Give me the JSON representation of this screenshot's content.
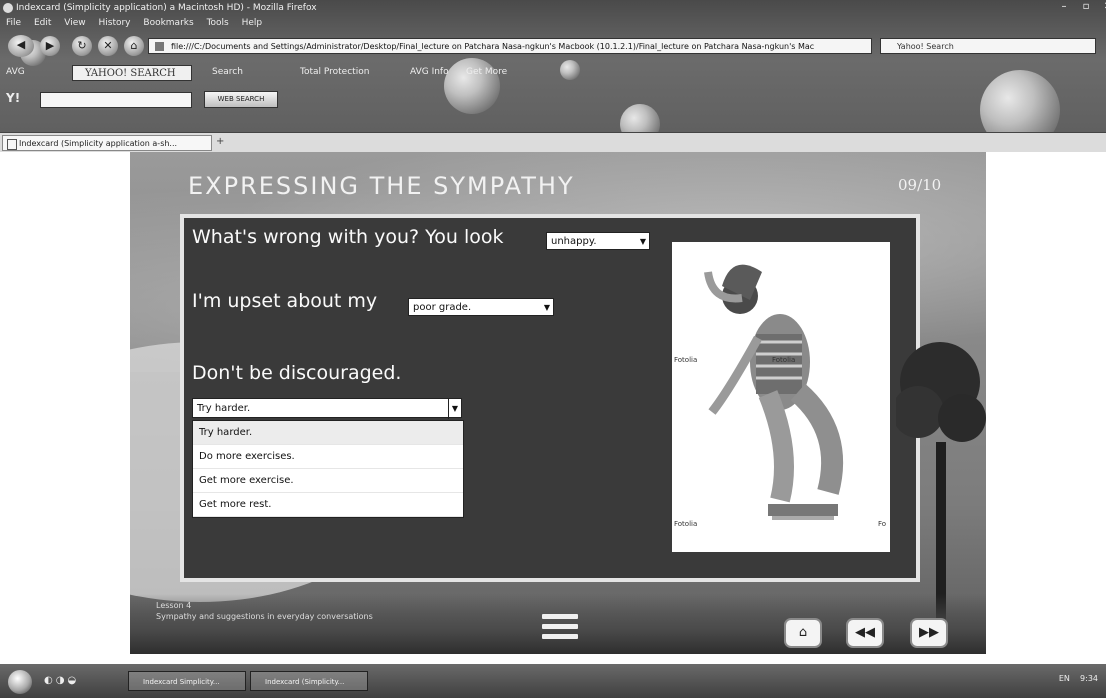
{
  "browser": {
    "title": "Indexcard (Simplicity application) a Macintosh HD) - Mozilla Firefox",
    "menu": [
      "File",
      "Edit",
      "View",
      "History",
      "Bookmarks",
      "Tools",
      "Help"
    ],
    "url": "file:///C:/Documents and Settings/Administrator/Desktop/Final_lecture on Patchara Nasa-ngkun's Macbook (10.1.2.1)/Final_lecture on Patchara Nasa-ngkun's Mac",
    "search_placeholder": "Yahoo! Search",
    "toolbar": {
      "avg": "AVG",
      "yahoo_logo": "YAHOO! SEARCH",
      "search_button": "Search",
      "total_protection": "Total Protection",
      "avg_info": "AVG Info",
      "get_more": "Get More"
    },
    "yahoo_toolbar": {
      "web_search": "WEB SEARCH"
    },
    "tab_title": "Indexcard (Simplicity application a-sh..."
  },
  "lesson": {
    "title": "Expressing the sympathy",
    "page": "09/10",
    "line1": "What's wrong with you? You look",
    "dropdown1": "unhappy.",
    "line2": "I'm upset about my",
    "dropdown2": "poor grade.",
    "line3": "Don't be discouraged.",
    "dropdown3": "Try harder.",
    "options": [
      "Try harder.",
      "Do more exercises.",
      "Get more exercise.",
      "Get more rest."
    ],
    "photo_labels": [
      "Fotolia",
      "Fotolia",
      "Fotolia",
      "Fo"
    ],
    "caption": [
      "Lesson 4",
      "Sympathy and suggestions in everyday conversations"
    ]
  },
  "taskbar": {
    "tasks": [
      "Indexcard Simplicity...",
      "Indexcard (Simplicity..."
    ],
    "tray": "EN",
    "clock": "9:34"
  }
}
